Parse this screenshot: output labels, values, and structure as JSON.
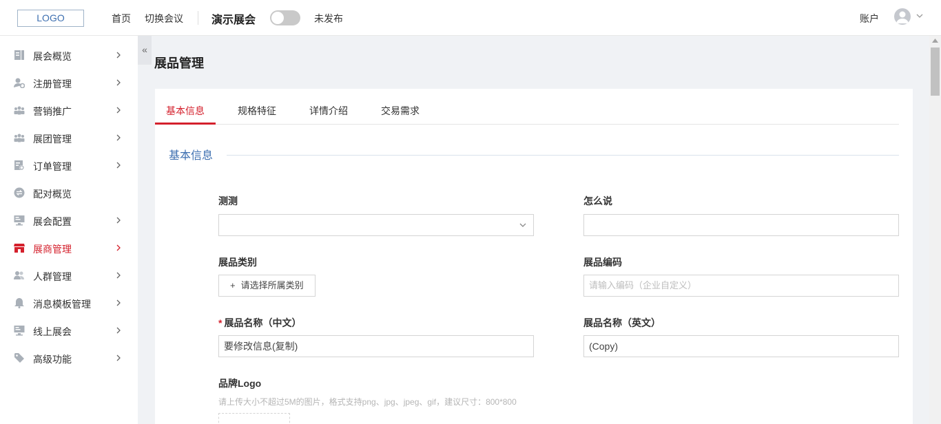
{
  "header": {
    "logo": "LOGO",
    "nav": [
      "首页",
      "切换会议"
    ],
    "event_title": "演示展会",
    "publish_status": "未发布",
    "publish_enabled": false,
    "account": "账户"
  },
  "sidebar": {
    "items": [
      {
        "label": "展会概览",
        "icon": "document-icon",
        "has_arrow": true,
        "active": false
      },
      {
        "label": "注册管理",
        "icon": "user-settings-icon",
        "has_arrow": true,
        "active": false
      },
      {
        "label": "营销推广",
        "icon": "group-icon",
        "has_arrow": true,
        "active": false
      },
      {
        "label": "展团管理",
        "icon": "group-icon",
        "has_arrow": true,
        "active": false
      },
      {
        "label": "订单管理",
        "icon": "order-icon",
        "has_arrow": true,
        "active": false
      },
      {
        "label": "配对概览",
        "icon": "match-icon",
        "has_arrow": false,
        "active": false
      },
      {
        "label": "展会配置",
        "icon": "monitor-icon",
        "has_arrow": true,
        "active": false
      },
      {
        "label": "展商管理",
        "icon": "store-icon",
        "has_arrow": true,
        "active": true
      },
      {
        "label": "人群管理",
        "icon": "people-icon",
        "has_arrow": true,
        "active": false
      },
      {
        "label": "消息模板管理",
        "icon": "bell-icon",
        "has_arrow": true,
        "active": false
      },
      {
        "label": "线上展会",
        "icon": "monitor-icon",
        "has_arrow": true,
        "active": false
      },
      {
        "label": "高级功能",
        "icon": "tag-icon",
        "has_arrow": true,
        "active": false
      }
    ],
    "collapse_label": "«"
  },
  "page": {
    "title": "展品管理",
    "tabs": [
      {
        "label": "基本信息",
        "active": true
      },
      {
        "label": "规格特征",
        "active": false
      },
      {
        "label": "详情介绍",
        "active": false
      },
      {
        "label": "交易需求",
        "active": false
      }
    ],
    "section_title": "基本信息"
  },
  "form": {
    "ceshi_label": "测测",
    "ceshi_value": "",
    "zenmeshuo_label": "怎么说",
    "zenmeshuo_value": "",
    "category_label": "展品类别",
    "category_button": "请选择所属类别",
    "code_label": "展品编码",
    "code_placeholder": "请输入编码（企业自定义）",
    "name_cn_label": "展品名称（中文）",
    "name_cn_required": "*",
    "name_cn_value": "要修改信息(复制)",
    "name_en_label": "展品名称（英文）",
    "name_en_value": "(Copy)",
    "brand_logo_label": "品牌Logo",
    "brand_logo_hint": "请上传大小不超过5M的图片，格式支持png、jpg、jpeg、gif，建议尺寸：800*800"
  },
  "colors": {
    "accent": "#d4202c",
    "section": "#3d6fb0",
    "background": "#f0f2f5"
  }
}
